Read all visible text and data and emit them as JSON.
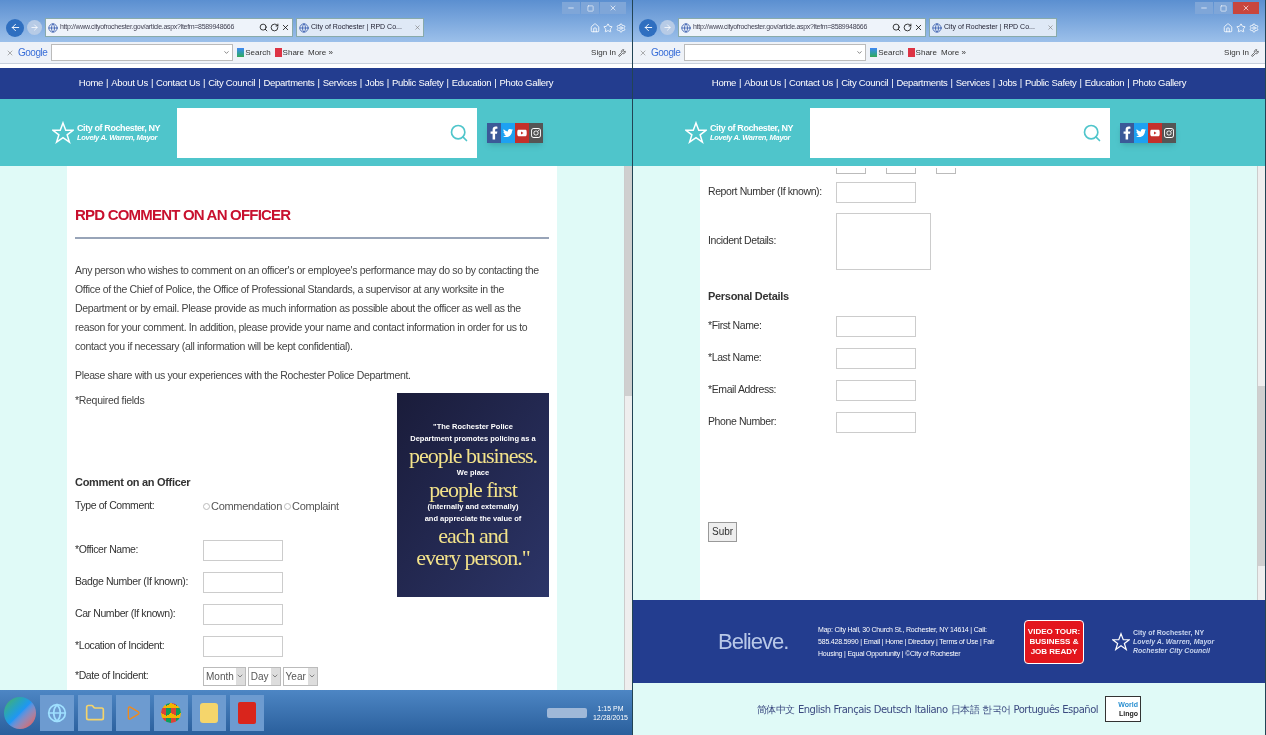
{
  "windows": [
    {
      "address": "http://www.cityofrochester.gov/article.aspx?ltefm=8589948666",
      "tab": "City of Rochester | RPD Co...",
      "toolbar": {
        "brand": "Google",
        "search": "Search",
        "share": "Share",
        "more": "More »",
        "sign_in": "Sign In"
      },
      "nav": [
        "Home",
        "About Us",
        "Contact Us",
        "City Council",
        "Departments",
        "Services",
        "Jobs",
        "Public Safety",
        "Education",
        "Photo Gallery"
      ],
      "nav_separator": "|",
      "site": {
        "name": "City of Rochester, NY",
        "mayor": "Lovely A. Warren, Mayor"
      },
      "content": {
        "title": "RPD COMMENT ON AN OFFICER",
        "paragraphs": [
          "Any person who wishes to comment on an officer's or employee's performance may do so by contacting the Office of the Chief of Police, the Office of Professional Standards, a supervisor at any worksite in the Department or by email. Please provide as much information as possible about the officer as well as the reason for your comment. In addition, please provide your name and contact information in order for us to contact you if necessary (all information will be kept confidential).",
          "Please share with us your experiences with the Rochester Police Department."
        ],
        "required_note": "*Required fields",
        "poster": [
          "\"The Rochester Police",
          "Department promotes policing as a",
          "people business.",
          "We place",
          "people first",
          "(internally and externally)",
          "and appreciate the value of",
          "each and",
          "every person.\""
        ],
        "form_items": [
          {
            "kind": "heading",
            "label": "Comment on an Officer"
          },
          {
            "kind": "radio",
            "label": "Type of Comment:",
            "options": [
              {
                "label": "Commendation",
                "selected": false
              },
              {
                "label": "Complaint",
                "selected": false
              }
            ]
          },
          {
            "kind": "text",
            "label": "*Officer Name:"
          },
          {
            "kind": "text",
            "label": "Badge Number (If known):"
          },
          {
            "kind": "text",
            "label": "Car Number (If known):"
          },
          {
            "kind": "text",
            "label": "*Location of Incident:"
          },
          {
            "kind": "date",
            "label": "*Date of Incident:",
            "selects": [
              "Month",
              "Day",
              "Year"
            ]
          }
        ]
      },
      "taskbar": {
        "time": "1:15 PM",
        "date": "12/28/2015"
      }
    },
    {
      "address": "http://www.cityofrochester.gov/article.aspx?ltefm=8589948666",
      "tab": "City of Rochester | RPD Co...",
      "toolbar": {
        "brand": "Google",
        "search": "Search",
        "share": "Share",
        "more": "More »",
        "sign_in": "Sign In"
      },
      "nav": [
        "Home",
        "About Us",
        "Contact Us",
        "City Council",
        "Departments",
        "Services",
        "Jobs",
        "Public Safety",
        "Education",
        "Photo Gallery"
      ],
      "nav_separator": "|",
      "site": {
        "name": "City of Rochester, NY",
        "mayor": "Lovely A. Warren, Mayor"
      },
      "content": {
        "form_items": [
          {
            "kind": "date_cut"
          },
          {
            "kind": "text",
            "label": "Report Number (If known):"
          },
          {
            "kind": "textarea",
            "label": "Incident Details:"
          },
          {
            "kind": "heading",
            "label": "Personal Details"
          },
          {
            "kind": "text",
            "label": "*First Name:"
          },
          {
            "kind": "text",
            "label": "*Last Name:"
          },
          {
            "kind": "text",
            "label": "*Email Address:"
          },
          {
            "kind": "text",
            "label": "Phone Number:"
          },
          {
            "kind": "submit",
            "label": "Subr"
          }
        ]
      },
      "footer": {
        "logo": "Believe.",
        "info": "Map: City Hall, 30 Church St., Rochester, NY 14614 | Call: 585.428.5990 | Email | Home | Directory | Terms of Use | Fair Housing | Equal Opportunity | ©City of Rochester",
        "video_badge": [
          "VIDEO TOUR:",
          "BUSINESS &",
          "JOB READY"
        ],
        "org": [
          "City of Rochester, NY",
          "Lovely A. Warren, Mayor",
          "Rochester City Council"
        ]
      },
      "languages": {
        "items": [
          "简体中文",
          "English",
          "Français",
          "Deutsch",
          "Italiano",
          "日本語",
          "한국어",
          "Português",
          "Español"
        ],
        "badge": [
          "World",
          "Lingo"
        ]
      }
    }
  ]
}
